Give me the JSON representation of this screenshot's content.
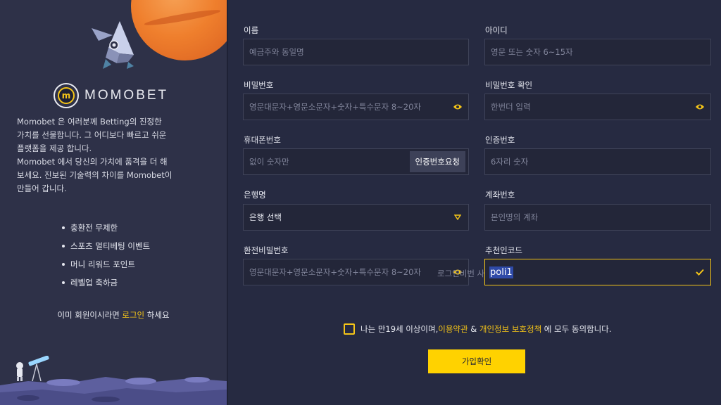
{
  "brand": {
    "name": "MOMOBET",
    "mark": "m"
  },
  "intro": {
    "line1": "Momobet 은 여러분께 Betting의 진정한",
    "line2": "가치를 선물합니다. 그 어디보다 빠르고 쉬운",
    "line3": "플랫폼을 제공 합니다.",
    "line4": "Momobet 에서 당신의 가치에 품격을 더 해",
    "line5": "보세요. 진보된 기술력의 차이를 Momobet이",
    "line6": "만들어 갑니다."
  },
  "features": [
    "충환전 무제한",
    "스포츠 멀티베팅 이벤트",
    "머니 리워드 포인트",
    "레벨업 축하금"
  ],
  "login": {
    "prefix": "이미 회원이시라면 ",
    "link": "로그인",
    "suffix": " 하세요"
  },
  "form": {
    "name": {
      "label": "이름",
      "placeholder": "예금주와 동일명"
    },
    "userid": {
      "label": "아이디",
      "placeholder": "영문 또는 숫자 6~15자"
    },
    "password": {
      "label": "비밀번호",
      "placeholder": "영문대문자+영문소문자+숫자+특수문자 8~20자"
    },
    "password_confirm": {
      "label": "비밀번호 확인",
      "placeholder": "한번더 입력"
    },
    "phone": {
      "label": "휴대폰번호",
      "placeholder": "없이 숫자만",
      "button": "인증번호요청"
    },
    "auth_code": {
      "label": "인증번호",
      "placeholder": "6자리 숫자"
    },
    "bank": {
      "label": "은행명",
      "selected": "은행 선택"
    },
    "account": {
      "label": "계좌번호",
      "placeholder": "본인명의 계좌"
    },
    "withdraw_pw": {
      "label": "환전비밀번호",
      "placeholder": "영문대문자+영문소문자+숫자+특수문자 8~20자",
      "overlay": "로그인비번 사"
    },
    "referral": {
      "label": "추천인코드",
      "value": "poli1"
    }
  },
  "agreement": {
    "prefix": "나는 만19세 이상이며,",
    "terms": "이용약관",
    "amp": " & ",
    "privacy": "개인정보 보호정책",
    "suffix": " 에 모두 동의합니다."
  },
  "submit_label": "가입확인",
  "colors": {
    "accent": "#f5c518",
    "background": "#262a41",
    "panel": "#2e3148",
    "button": "#ffd200"
  }
}
